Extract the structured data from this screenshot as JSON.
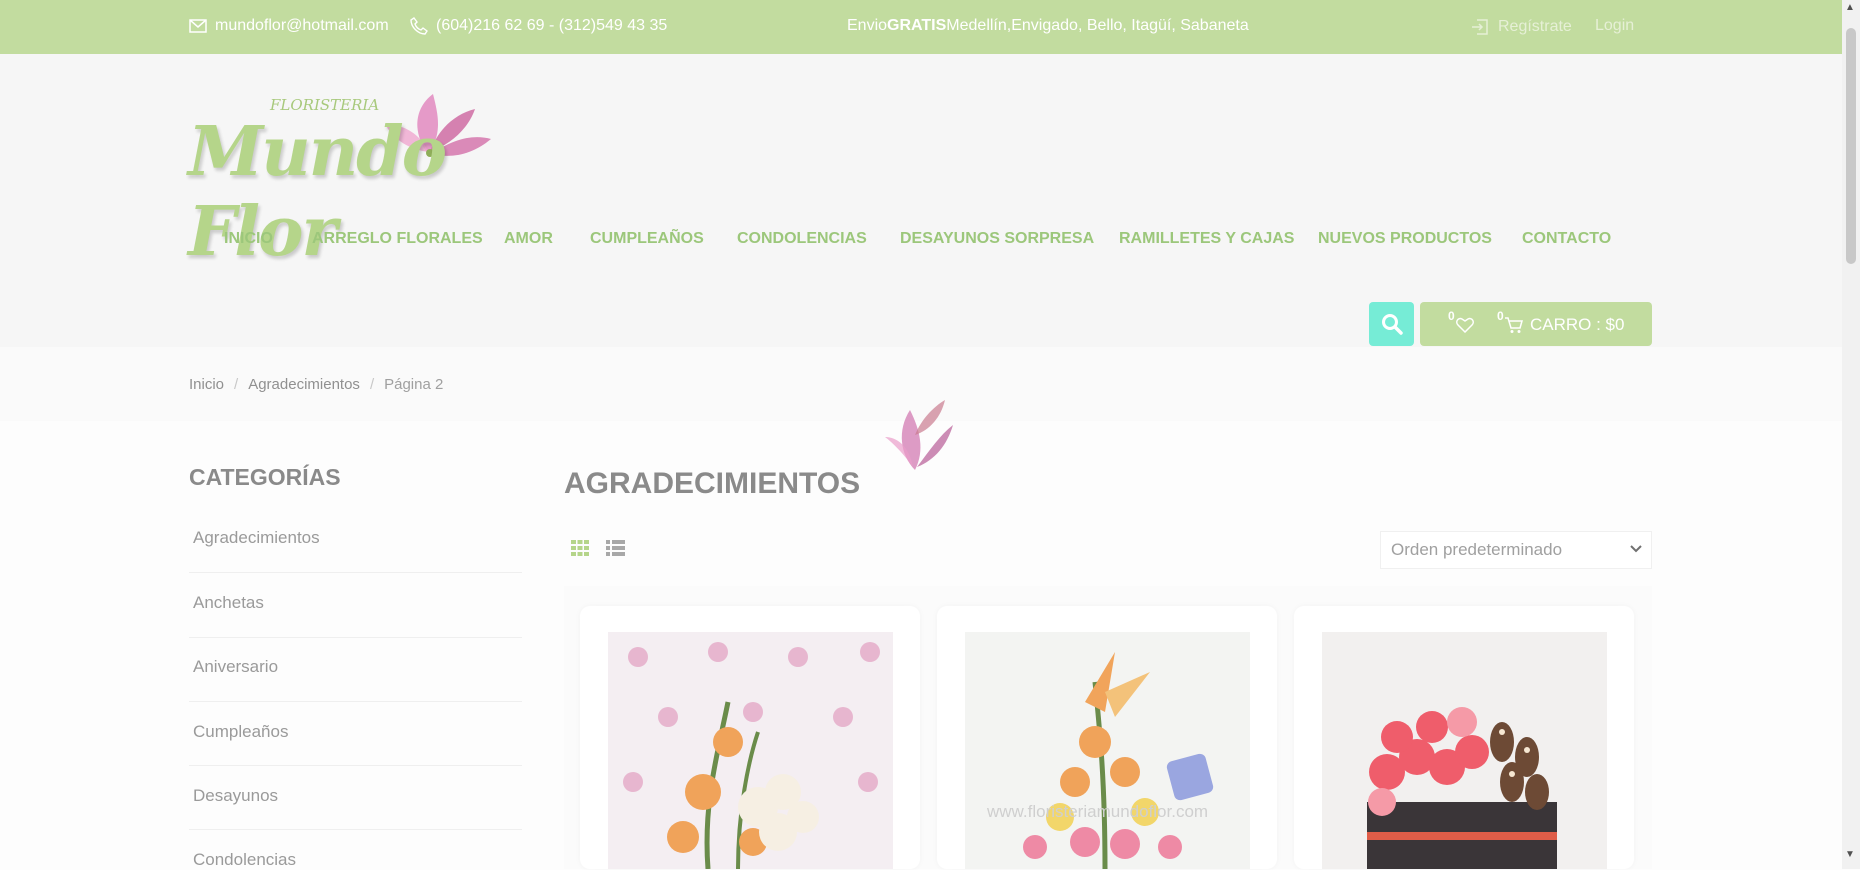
{
  "topbar": {
    "email": "mundoflor@hotmail.com",
    "phone": "(604)216 62 69 - (312)549 43 35",
    "shipping_prefix": "Envio ",
    "shipping_bold": "GRATIS",
    "shipping_rest": " Medellín,Envigado, Bello, Itagüí, Sabaneta",
    "register": "Regístrate",
    "login": "Login"
  },
  "logo": {
    "small": "FLORISTERIA",
    "script": "Mundo Flor"
  },
  "nav": [
    "INICIO",
    "ARREGLO FLORALES",
    "AMOR",
    "CUMPLEAÑOS",
    "CONDOLENCIAS",
    "DESAYUNOS SORPRESA",
    "RAMILLETES Y CAJAS",
    "NUEVOS PRODUCTOS",
    "CONTACTO"
  ],
  "cart": {
    "wishlist_count": "0",
    "cart_count": "0",
    "label": "CARRO : $0"
  },
  "breadcrumb": [
    "Inicio",
    "Agradecimientos",
    "Página 2"
  ],
  "sidebar": {
    "title": "CATEGORÍAS",
    "items": [
      "Agradecimientos",
      "Anchetas",
      "Aniversario",
      "Cumpleaños",
      "Desayunos",
      "Condolencias"
    ]
  },
  "main": {
    "title": "AGRADECIMIENTOS",
    "sort_selected": "Orden predeterminado"
  },
  "product_watermark": "www.floristeriamundoflor.com",
  "colors": {
    "brand_green": "#c2dc9f",
    "nav_green": "#9cc77b",
    "search_teal": "#76ecd6"
  },
  "icons": [
    "mail-icon",
    "phone-icon",
    "login-icon",
    "search-icon",
    "heart-icon",
    "cart-icon",
    "grid-view-icon",
    "list-view-icon",
    "chevron-down-icon"
  ]
}
